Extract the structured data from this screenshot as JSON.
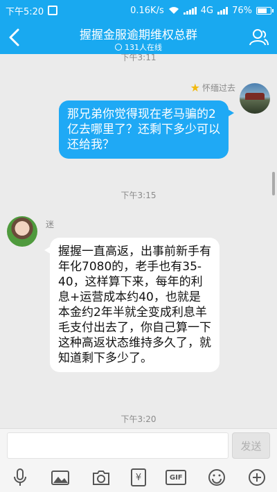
{
  "status_bar": {
    "time": "下午5:20",
    "speed": "0.16K/s",
    "network": "4G",
    "battery": "76%",
    "battery_level": 0.76
  },
  "header": {
    "title": "握握金服逾期维权总群",
    "subtitle": "131人在线"
  },
  "chat": {
    "messages": [
      {
        "type": "timestamp",
        "text": "下午3:11"
      },
      {
        "type": "message",
        "side": "right",
        "sender": "怀缅过去",
        "text": "那兄弟你觉得现在老马骗的2亿去哪里了？还剩下多少可以还给我？"
      },
      {
        "type": "timestamp",
        "text": "下午3:15"
      },
      {
        "type": "message",
        "side": "left",
        "sender": "迷",
        "text": "握握一直高返，出事前新手有年化7080的，老手也有35-40，这样算下来，每年的利息+运营成本约40，也就是本金约2年半就全变成利息羊毛支付出去了，你自己算一下这种高返状态维持多久了，就知道剩下多少了。"
      },
      {
        "type": "timestamp",
        "text": "下午3:20"
      }
    ]
  },
  "input_bar": {
    "value": "",
    "send_label": "发送"
  },
  "toolbar": {
    "items": [
      "mic-icon",
      "image-icon",
      "camera-icon",
      "red-packet-icon",
      "gif-icon",
      "emoji-icon",
      "plus-icon"
    ],
    "gif_label": "GIF",
    "red_packet_label": "¥"
  },
  "colors": {
    "brand": "#19a9f0",
    "bubble_right": "#1fa9f5",
    "bubble_left": "#ffffff",
    "background": "#ebebeb"
  }
}
